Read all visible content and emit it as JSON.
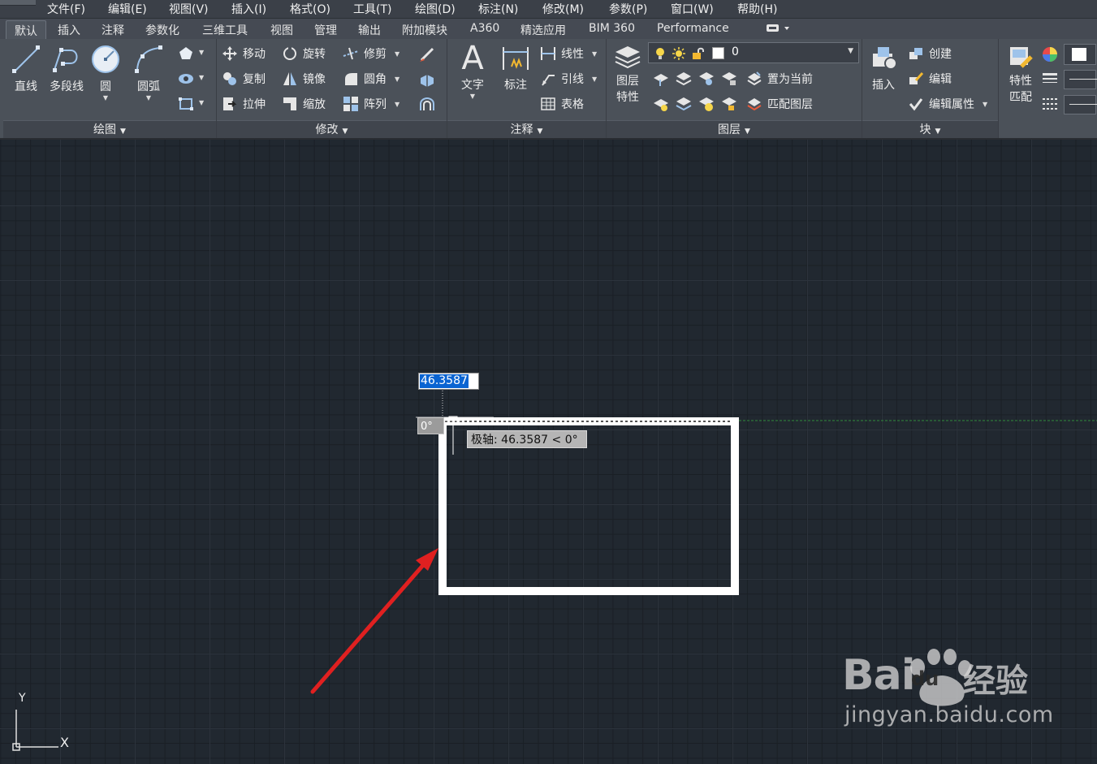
{
  "menu": [
    "文件(F)",
    "编辑(E)",
    "视图(V)",
    "插入(I)",
    "格式(O)",
    "工具(T)",
    "绘图(D)",
    "标注(N)",
    "修改(M)",
    "参数(P)",
    "窗口(W)",
    "帮助(H)"
  ],
  "tabs": [
    "默认",
    "插入",
    "注释",
    "参数化",
    "三维工具",
    "视图",
    "管理",
    "输出",
    "附加模块",
    "A360",
    "精选应用",
    "BIM 360",
    "Performance"
  ],
  "active_tab": "默认",
  "panels": {
    "draw": {
      "title": "绘图",
      "line": "直线",
      "polyline": "多段线",
      "circle": "圆",
      "arc": "圆弧"
    },
    "modify": {
      "title": "修改",
      "move": "移动",
      "rotate": "旋转",
      "trim": "修剪",
      "copy": "复制",
      "mirror": "镜像",
      "fillet": "圆角",
      "stretch": "拉伸",
      "scale": "缩放",
      "array": "阵列"
    },
    "annotation": {
      "title": "注释",
      "text": "文字",
      "dimension": "标注",
      "linear": "线性",
      "leader": "引线",
      "table": "表格"
    },
    "layers": {
      "title": "图层",
      "properties_l1": "图层",
      "properties_l2": "特性",
      "current_layer": "0",
      "set_current": "置为当前",
      "match_layer": "匹配图层"
    },
    "block": {
      "title": "块",
      "insert": "插入",
      "create": "创建",
      "edit": "编辑",
      "edit_attributes": "编辑属性"
    },
    "properties": {
      "match_l1": "特性",
      "match_l2": "匹配"
    }
  },
  "canvas": {
    "dynamic_input_value": "46.3587",
    "angle_label": "0°",
    "polar_tooltip": "极轴: 46.3587 < 0°",
    "ucs_y": "Y",
    "ucs_x": "X"
  },
  "colors": {
    "canvas_bg": "#212830",
    "rectangle": "#ffffff",
    "arrow": "#e02020",
    "tracking_line": "#2f8a3a",
    "highlight": "#0a64d2"
  },
  "watermark": {
    "bai": "Bai",
    "du": "du",
    "brand_cn": "经验",
    "url": "jingyan.baidu.com"
  }
}
